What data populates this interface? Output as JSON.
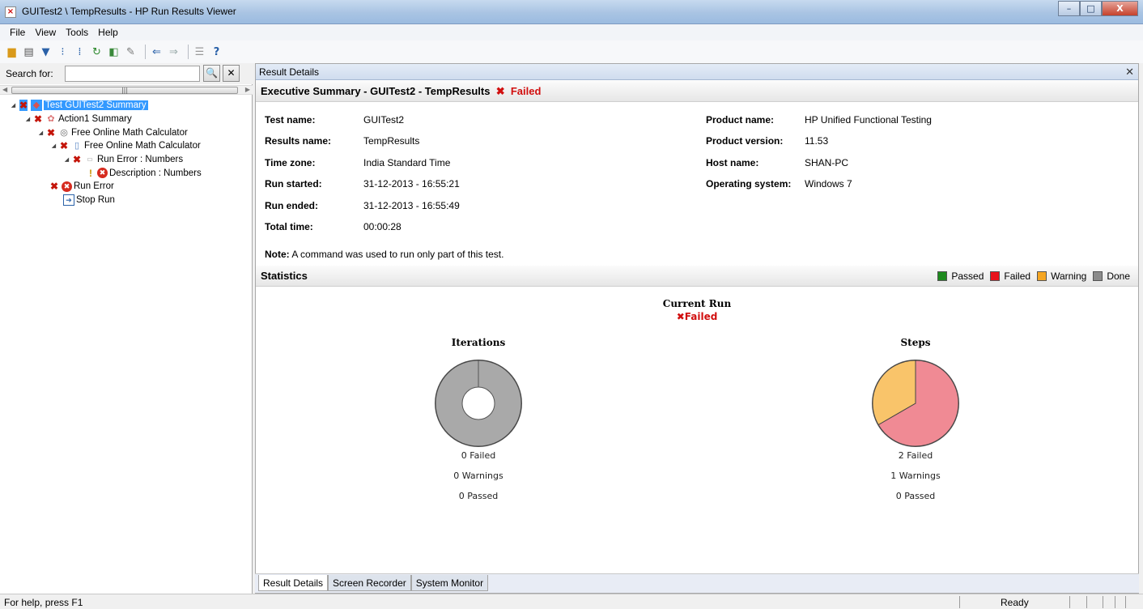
{
  "window": {
    "title": "GUITest2 \\ TempResults - HP Run Results Viewer",
    "minimize": "–",
    "maximize": "□",
    "close": "X"
  },
  "menu": [
    "File",
    "View",
    "Tools",
    "Help"
  ],
  "toolbar": {
    "icons": [
      "open-icon",
      "print-icon",
      "filter-icon",
      "expand-all-icon",
      "collapse-all-icon",
      "refresh-icon",
      "export-icon",
      "edit-icon",
      "back-icon",
      "forward-icon",
      "list-icon",
      "help-icon"
    ]
  },
  "search": {
    "label": "Search for:",
    "value": "",
    "search_button": "🔍",
    "clear_button": "✕"
  },
  "tree": [
    {
      "label": "Test GUITest2 Summary",
      "status": "failed",
      "icon": "test-icon",
      "selected": true,
      "expander": "◢"
    },
    {
      "label": "Action1 Summary",
      "status": "failed",
      "icon": "action-icon",
      "expander": "◢"
    },
    {
      "label": "Free Online Math Calculator",
      "status": "failed",
      "icon": "browser-icon",
      "expander": "◢"
    },
    {
      "label": "Free Online Math Calculator",
      "status": "failed",
      "icon": "page-icon",
      "expander": "◢"
    },
    {
      "label": "Run Error : Numbers",
      "status": "failed",
      "icon": "webedit-icon",
      "expander": "◢"
    },
    {
      "label": "Description : Numbers",
      "status": "warning",
      "icon": "error-icon"
    },
    {
      "label": "Run Error",
      "status": "failed",
      "icon": "error-icon"
    },
    {
      "label": "Stop Run",
      "status": "none",
      "icon": "stop-run-icon"
    }
  ],
  "panel": {
    "title": "Result Details",
    "close": "✕"
  },
  "summary": {
    "heading": "Executive Summary - GUITest2 - TempResults",
    "status": "Failed",
    "left_fields": [
      {
        "label": "Test name:",
        "value": "GUITest2"
      },
      {
        "label": "Results name:",
        "value": "TempResults"
      },
      {
        "label": "Time zone:",
        "value": "India Standard Time"
      },
      {
        "label": "Run started:",
        "value": "31-12-2013 - 16:55:21"
      },
      {
        "label": "Run ended:",
        "value": "31-12-2013 - 16:55:49"
      },
      {
        "label": "Total time:",
        "value": "00:00:28"
      }
    ],
    "right_fields": [
      {
        "label": "Product name:",
        "value": "HP Unified Functional Testing"
      },
      {
        "label": "Product version:",
        "value": "11.53"
      },
      {
        "label": "Host name:",
        "value": "SHAN-PC"
      },
      {
        "label": "Operating system:",
        "value": "Windows 7"
      }
    ],
    "note_label": "Note:",
    "note_text": " A command was used to run only part of this test."
  },
  "statistics": {
    "heading": "Statistics",
    "legend": [
      {
        "label": "Passed",
        "color": "#1e8a1e"
      },
      {
        "label": "Failed",
        "color": "#e8141c"
      },
      {
        "label": "Warning",
        "color": "#f5a623"
      },
      {
        "label": "Done",
        "color": "#8c8c8c"
      }
    ],
    "current_run_title": "Current Run",
    "current_run_status": "Failed"
  },
  "chart_data": [
    {
      "type": "pie",
      "title": "Iterations",
      "categories": [
        "Done"
      ],
      "values": [
        1
      ],
      "colors": [
        "#a9a9a9"
      ],
      "captions": [
        "0 Failed",
        "0 Warnings",
        "0 Passed"
      ]
    },
    {
      "type": "pie",
      "title": "Steps",
      "categories": [
        "Failed",
        "Warning"
      ],
      "values": [
        2,
        1
      ],
      "colors": [
        "#f08a94",
        "#f9c46a"
      ],
      "captions": [
        "2 Failed",
        "1 Warnings",
        "0 Passed"
      ]
    }
  ],
  "tabs": [
    "Result Details",
    "Screen Recorder",
    "System Monitor"
  ],
  "status": {
    "help": "For help, press F1",
    "ready": "Ready"
  }
}
